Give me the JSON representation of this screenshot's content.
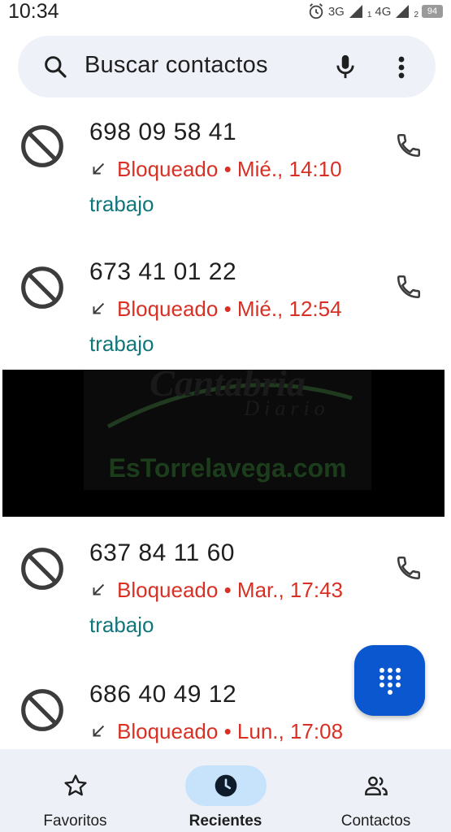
{
  "status_bar": {
    "time": "10:34",
    "network_1": "3G",
    "sim_1": "1",
    "network_2": "4G",
    "sim_2": "2",
    "battery": "94",
    "icons": [
      "alarm-icon",
      "signal-icon",
      "battery-icon"
    ]
  },
  "search": {
    "placeholder": "Buscar contactos",
    "icons": [
      "search-icon",
      "mic-icon",
      "more-vert-icon"
    ]
  },
  "calls": [
    {
      "number": "698 09 58 41",
      "status": "Bloqueado",
      "separator": "•",
      "time": "Mié., 14:10",
      "label": "trabajo"
    },
    {
      "number": "673 41 01 22",
      "status": "Bloqueado",
      "separator": "•",
      "time": "Mié., 12:54",
      "label": "trabajo"
    },
    {
      "number": "637 84 11 60",
      "status": "Bloqueado",
      "separator": "•",
      "time": "Mar., 17:43",
      "label": "trabajo"
    },
    {
      "number": "686 40 49 12",
      "status": "Bloqueado",
      "separator": "•",
      "time": "Lun., 17:08"
    }
  ],
  "watermark": {
    "brand": "Cantabria",
    "sub": "Diario",
    "site": "EsTorrelavega.com"
  },
  "bottom_nav": {
    "items": [
      {
        "label": "Favoritos",
        "icon": "star-icon",
        "active": false
      },
      {
        "label": "Recientes",
        "icon": "clock-icon",
        "active": true
      },
      {
        "label": "Contactos",
        "icon": "people-icon",
        "active": false
      }
    ]
  },
  "colors": {
    "accent": "#0b57d0",
    "blocked": "#d93025",
    "label": "#10767a",
    "nav_active": "#c7e3fb",
    "search_bg": "#eef1f8"
  }
}
